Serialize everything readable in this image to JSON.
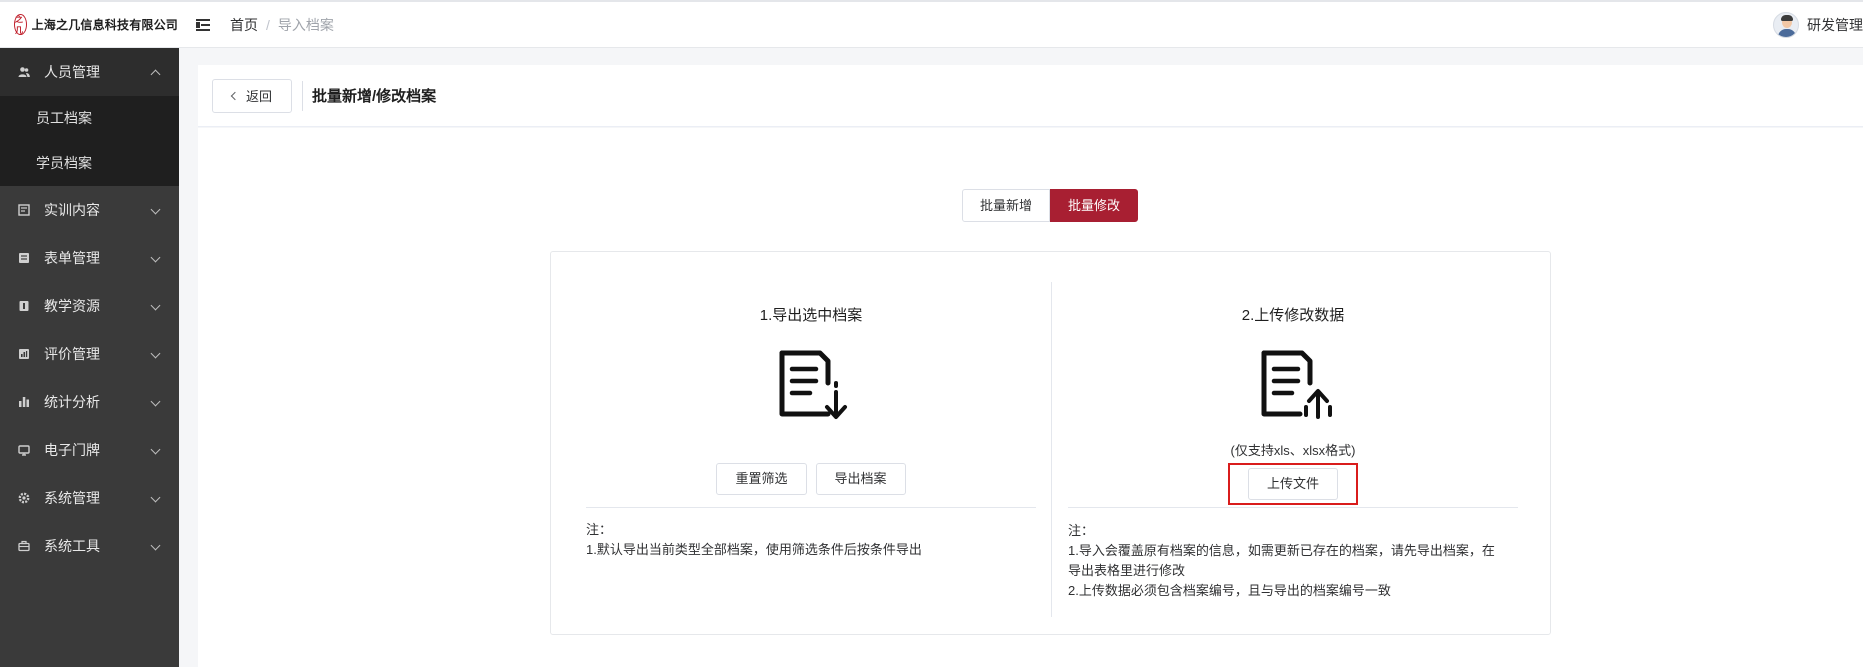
{
  "header": {
    "logo_mark": "之几",
    "company": "上海之几信息科技有限公司",
    "breadcrumb": {
      "home": "首页",
      "separator": "/",
      "current": "导入档案"
    },
    "user_name": "研发管理"
  },
  "sidebar": {
    "groups": [
      {
        "label": "人员管理",
        "expanded": true,
        "icon": "users-icon",
        "children": [
          "员工档案",
          "学员档案"
        ]
      },
      {
        "label": "实训内容",
        "icon": "content-icon"
      },
      {
        "label": "表单管理",
        "icon": "form-icon"
      },
      {
        "label": "教学资源",
        "icon": "resource-icon"
      },
      {
        "label": "评价管理",
        "icon": "evaluation-icon"
      },
      {
        "label": "统计分析",
        "icon": "chart-icon"
      },
      {
        "label": "电子门牌",
        "icon": "monitor-icon"
      },
      {
        "label": "系统管理",
        "icon": "gear-icon"
      },
      {
        "label": "系统工具",
        "icon": "toolbox-icon"
      }
    ]
  },
  "page": {
    "back_label": "返回",
    "title": "批量新增/修改档案",
    "mode_tabs": [
      "批量新增",
      "批量修改"
    ],
    "active_tab": "批量修改"
  },
  "left_panel": {
    "title": "1.导出选中档案",
    "icon": "document-download-icon",
    "buttons": [
      "重置筛选",
      "导出档案"
    ],
    "notes": [
      "注：",
      "1.默认导出当前类型全部档案，使用筛选条件后按条件导出"
    ]
  },
  "right_panel": {
    "title": "2.上传修改数据",
    "icon": "document-upload-icon",
    "formats": "(仅支持xls、xlsx格式)",
    "upload_label": "上传文件",
    "notes": [
      "注：",
      "1.导入会覆盖原有档案的信息，如需更新已存在的档案，请先导出档案，在",
      "导出表格里进行修改",
      "2.上传数据必须包含档案编号，且与导出的档案编号一致"
    ]
  },
  "colors": {
    "accent": "#a81f32",
    "sidebar_bg": "#3a3a3a",
    "highlight_box": "#d91c1c"
  }
}
